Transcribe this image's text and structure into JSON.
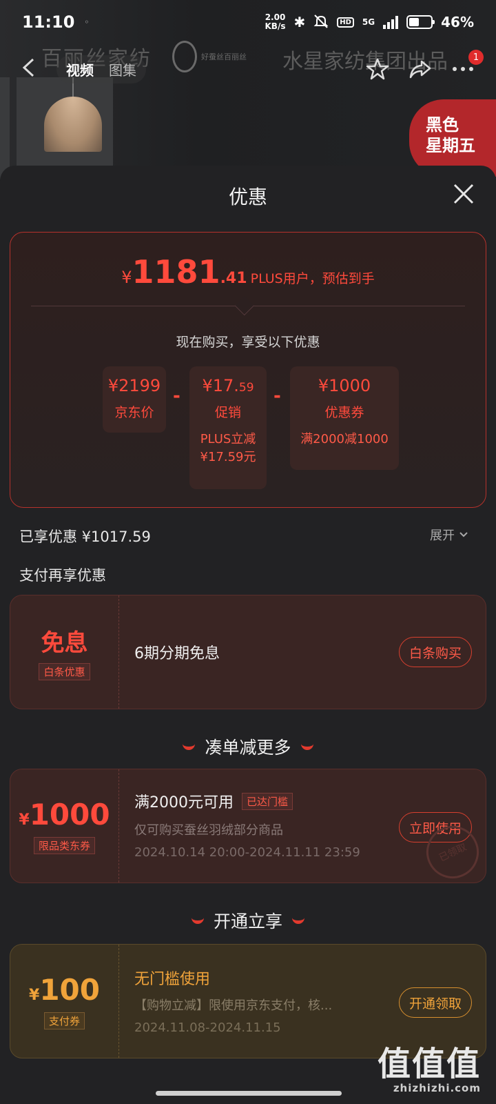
{
  "status": {
    "time": "11:10",
    "speed_top": "2.00",
    "speed_bottom": "KB/s",
    "hd": "HD",
    "network": "5G",
    "battery_percent": "46%",
    "battery_level": 0.46
  },
  "header": {
    "brand_left": "百丽丝家纺",
    "brand_logo_text": "好蚕丝百丽丝",
    "brand_right": "水星家纺集团出品",
    "tabs": [
      {
        "label": "视频",
        "active": true
      },
      {
        "label": "图集",
        "active": false
      }
    ],
    "cart_badge": "1",
    "promo_tag_line1": "黑色",
    "promo_tag_line2": "星期五"
  },
  "sheet": {
    "title": "优惠",
    "estimate": {
      "currency": "¥",
      "integer": "1181",
      "decimal": ".41",
      "suffix": "PLUS用户，预估到手"
    },
    "now_text": "现在购买，享受以下优惠",
    "breakdown": [
      {
        "amount": "¥2199",
        "label": "京东价",
        "note": ""
      },
      {
        "amount": "¥17.",
        "amount_small": "59",
        "label": "促销",
        "note_line1": "PLUS立减",
        "note_line2": "¥17.59元"
      },
      {
        "amount": "¥1000",
        "label": "优惠券",
        "note_line1": "满2000减1000"
      }
    ],
    "minus": "-",
    "enjoyed_text": "已享优惠 ¥1017.59",
    "expand_label": "展开",
    "pay_more_title": "支付再享优惠",
    "installment": {
      "big": "免息",
      "tag": "白条优惠",
      "desc": "6期分期免息",
      "button": "白条购买"
    },
    "section_more": "凑单减更多",
    "coupon": {
      "currency": "¥",
      "amount": "1000",
      "tag": "限品类东券",
      "title": "满2000元可用",
      "status": "已达门槛",
      "desc": "仅可购买蚕丝羽绒部分商品",
      "period": "2024.10.14 20:00-2024.11.11 23:59",
      "button": "立即使用",
      "stamp": "已领取"
    },
    "section_open": "开通立享",
    "pay_coupon": {
      "currency": "¥",
      "amount": "100",
      "tag": "支付券",
      "title": "无门槛使用",
      "desc": "【购物立减】限使用京东支付，核...",
      "period": "2024.11.08-2024.11.15",
      "button": "开通领取"
    }
  },
  "watermark": {
    "big": "值值值",
    "small": "zhizhizhi.com"
  },
  "colors": {
    "accent_red": "#ff4a3c",
    "gold": "#f0a33a",
    "sheet_bg": "#222224"
  }
}
